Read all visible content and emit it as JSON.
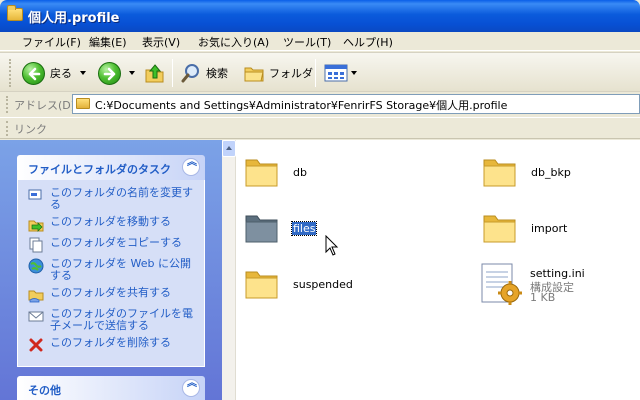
{
  "window": {
    "title": "個人用.profile"
  },
  "menu": [
    "ファイル(F)",
    "編集(E)",
    "表示(V)",
    "お気に入り(A)",
    "ツール(T)",
    "ヘルプ(H)"
  ],
  "toolbar": {
    "back": "戻る",
    "search": "検索",
    "folders": "フォルダ"
  },
  "address": {
    "label": "アドレス(D)",
    "path": "C:¥Documents and Settings¥Administrator¥FenrirFS Storage¥個人用.profile"
  },
  "links": {
    "label": "リンク"
  },
  "tasks": {
    "title": "ファイルとフォルダのタスク",
    "items": [
      "このフォルダの名前を変更する",
      "このフォルダを移動する",
      "このフォルダをコピーする",
      "このフォルダを Web に公開する",
      "このフォルダを共有する",
      "このフォルダのファイルを電子メールで送信する",
      "このフォルダを削除する"
    ]
  },
  "other": {
    "title": "その他"
  },
  "files": [
    {
      "name": "db",
      "type": "folder"
    },
    {
      "name": "db_bkp",
      "type": "folder"
    },
    {
      "name": "files",
      "type": "folder",
      "selected": true
    },
    {
      "name": "import",
      "type": "folder"
    },
    {
      "name": "suspended",
      "type": "folder"
    },
    {
      "name": "setting.ini",
      "type": "config",
      "kind": "構成設定",
      "size": "1 KB"
    }
  ]
}
